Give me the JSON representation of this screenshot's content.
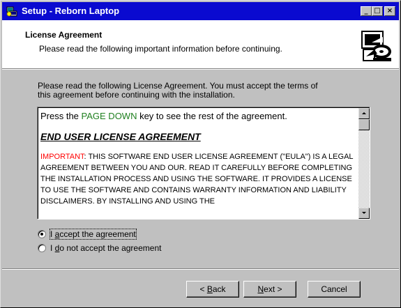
{
  "window": {
    "title": "Setup - Reborn Laptop",
    "minimize_glyph": "_",
    "maximize_glyph": "□",
    "close_glyph": "×"
  },
  "header": {
    "title": "License Agreement",
    "subtitle": "Please read the following important information before continuing.",
    "icon": "computer-disc-icon"
  },
  "intro": "Please read the following License Agreement. You must accept the terms of this agreement before continuing with the installation.",
  "license": {
    "line1_pre": "Press the ",
    "line1_key": "PAGE DOWN",
    "line1_post": " key to see the rest of the agreement.",
    "eula_title": "END USER LICENSE AGREEMENT",
    "important_label": "IMPORTANT",
    "important_text": ": THIS SOFTWARE END USER LICENSE AGREEMENT (\"EULA\") IS A LEGAL AGREEMENT BETWEEN YOU AND OUR. READ IT CAREFULLY BEFORE COMPLETING THE INSTALLATION PROCESS AND USING THE SOFTWARE. IT PROVIDES A LICENSE TO USE THE SOFTWARE AND CONTAINS WARRANTY INFORMATION AND LIABILITY DISCLAIMERS. BY INSTALLING AND USING THE"
  },
  "options": {
    "accept_pre": "I ",
    "accept_key": "a",
    "accept_post": "ccept the agreement",
    "decline_pre": "I ",
    "decline_key": "d",
    "decline_post": "o not accept the agreement",
    "selected": "accept"
  },
  "buttons": {
    "back_pre": "< ",
    "back_key": "B",
    "back_post": "ack",
    "next_key": "N",
    "next_post": "ext >",
    "cancel": "Cancel"
  },
  "colors": {
    "titlebar": "#0a0ad0",
    "dialog": "#c0c0c0",
    "highlight_green": "#208020",
    "important_red": "#ff0000"
  }
}
